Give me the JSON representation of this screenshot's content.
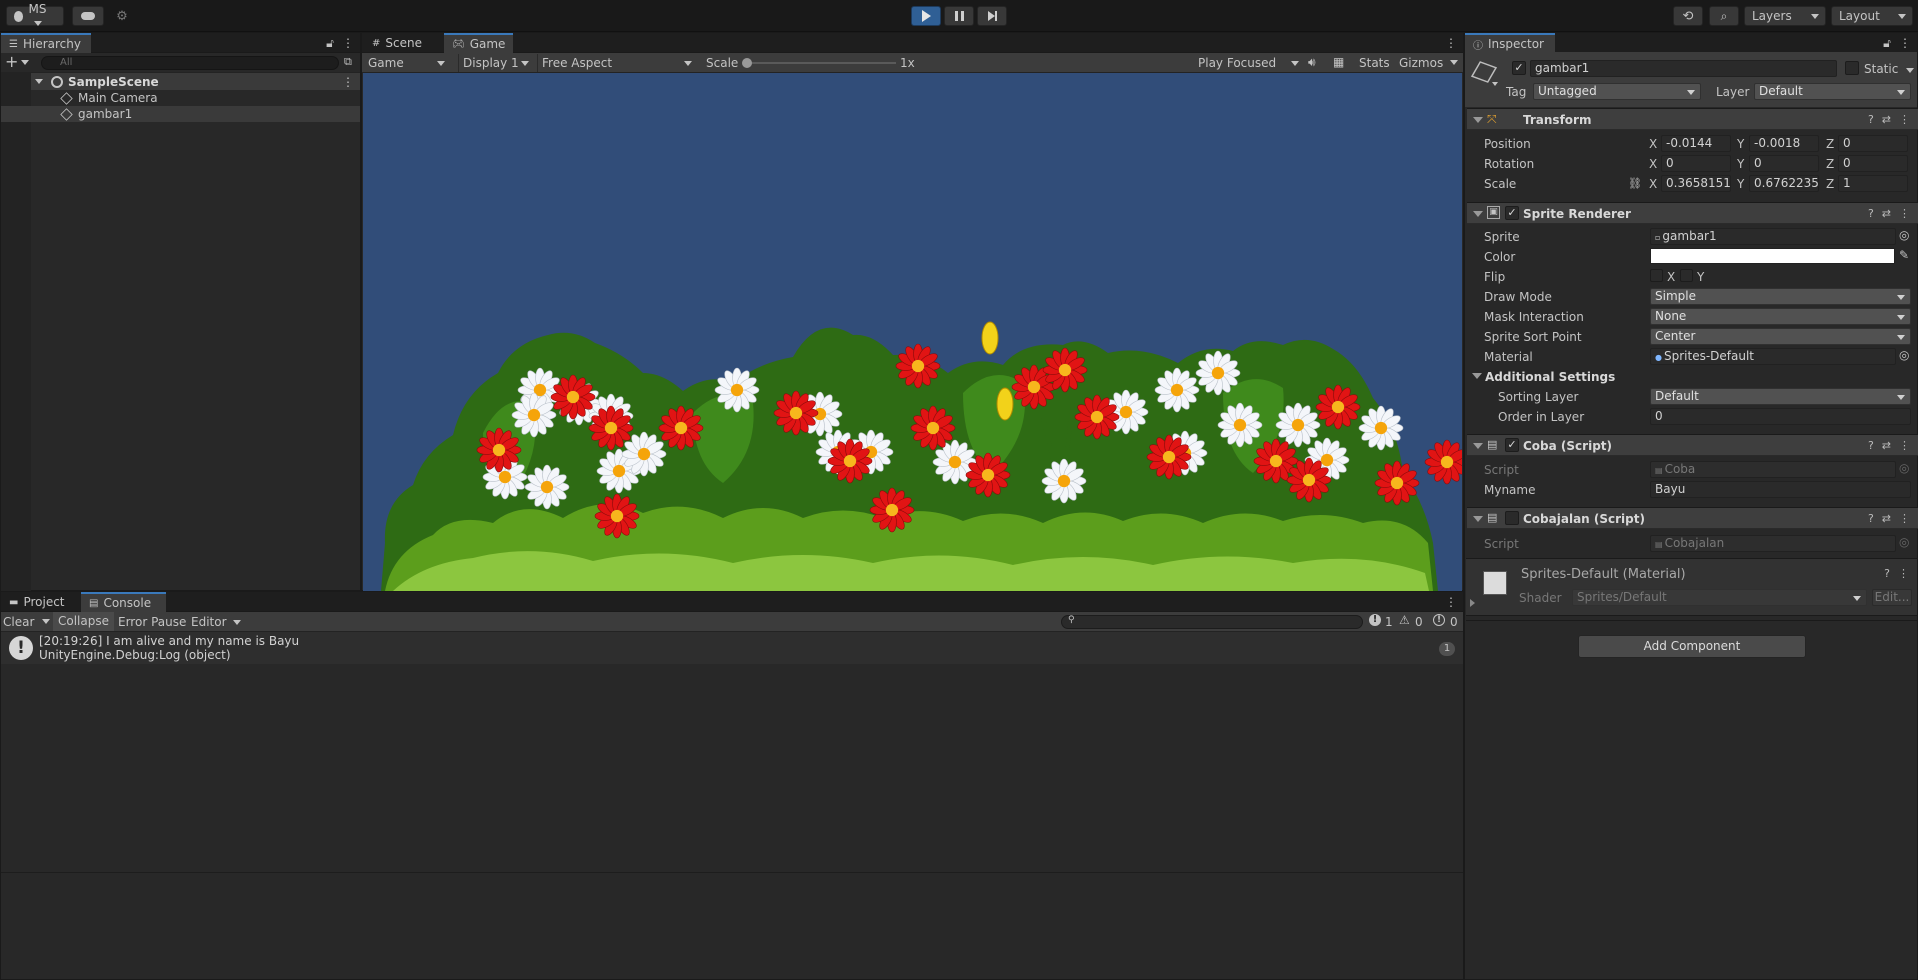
{
  "toolbar": {
    "account": "MS",
    "layers": "Layers",
    "layout": "Layout"
  },
  "hierarchy": {
    "tab": "Hierarchy",
    "search_placeholder": "All",
    "scene": "SampleScene",
    "items": [
      "Main Camera",
      "gambar1"
    ]
  },
  "game_view": {
    "tabs": [
      "Scene",
      "Game"
    ],
    "mode": "Game",
    "display": "Display 1",
    "aspect": "Free Aspect",
    "scale_label": "Scale",
    "scale_value": "1x",
    "play_mode": "Play Focused",
    "stats": "Stats",
    "gizmos": "Gizmos",
    "background_color": "#314d79"
  },
  "console": {
    "tabs": [
      "Project",
      "Console"
    ],
    "clear": "Clear",
    "collapse": "Collapse",
    "error_pause": "Error Pause",
    "editor": "Editor",
    "count_log": "1",
    "count_warn": "0",
    "count_error": "0",
    "log_line1": "[20:19:26] I am alive and my name is Bayu",
    "log_line2": "UnityEngine.Debug:Log (object)",
    "log_count": "1"
  },
  "inspector": {
    "tab": "Inspector",
    "object_name": "gambar1",
    "static_label": "Static",
    "tag_label": "Tag",
    "tag_value": "Untagged",
    "layer_label": "Layer",
    "layer_value": "Default",
    "transform": {
      "title": "Transform",
      "position_label": "Position",
      "rotation_label": "Rotation",
      "scale_label": "Scale",
      "position": [
        "-0.0144",
        "-0.0018",
        "0"
      ],
      "rotation": [
        "0",
        "0",
        "0"
      ],
      "scale": [
        "0.3658151",
        "0.6762235",
        "1"
      ],
      "x": "X",
      "y": "Y",
      "z": "Z"
    },
    "sprite_renderer": {
      "title": "Sprite Renderer",
      "sprite_label": "Sprite",
      "sprite_value": "gambar1",
      "color_label": "Color",
      "flip_label": "Flip",
      "flip_x": "X",
      "flip_y": "Y",
      "draw_mode_label": "Draw Mode",
      "draw_mode_value": "Simple",
      "mask_label": "Mask Interaction",
      "mask_value": "None",
      "sort_point_label": "Sprite Sort Point",
      "sort_point_value": "Center",
      "material_label": "Material",
      "material_value": "Sprites-Default",
      "additional": "Additional Settings",
      "sorting_layer_label": "Sorting Layer",
      "sorting_layer_value": "Default",
      "order_label": "Order in Layer",
      "order_value": "0"
    },
    "coba": {
      "title": "Coba (Script)",
      "script_label": "Script",
      "script_value": "Coba",
      "myname_label": "Myname",
      "myname_value": "Bayu"
    },
    "cobajalan": {
      "title": "Cobajalan (Script)",
      "script_label": "Script",
      "script_value": "Cobajalan"
    },
    "material": {
      "title": "Sprites-Default (Material)",
      "shader_label": "Shader",
      "shader_value": "Sprites/Default",
      "edit": "Edit..."
    },
    "add_component": "Add Component"
  }
}
